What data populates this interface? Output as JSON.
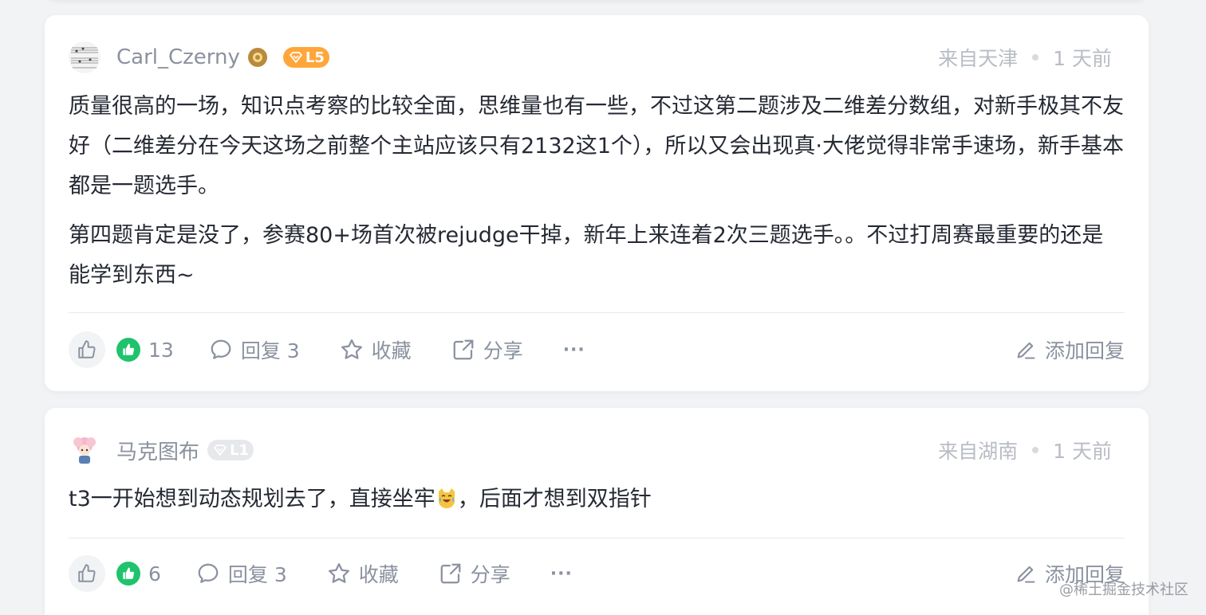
{
  "comments": [
    {
      "username": "Carl_Czerny",
      "level": "L5",
      "location": "来自天津",
      "time": "1 天前",
      "paragraphs": [
        "质量很高的一场，知识点考察的比较全面，思维量也有一些，不过这第二题涉及二维差分数组，对新手极其不友好（二维差分在今天这场之前整个主站应该只有2132这1个），所以又会出现真·大佬觉得非常手速场，新手基本都是一题选手。",
        "第四题肯定是没了，参赛80+场首次被rejudge干掉，新年上来连着2次三题选手。。不过打周赛最重要的还是能学到东西~"
      ],
      "likes": "13",
      "reply_label": "回复 3",
      "collect_label": "收藏",
      "share_label": "分享",
      "more_label": "···",
      "add_reply_label": "添加回复"
    },
    {
      "username": "马克图布",
      "level": "L1",
      "location": "来自湖南",
      "time": "1 天前",
      "content_before": "t3一开始想到动态规划去了，直接坐牢",
      "content_after": "，后面才想到双指针",
      "likes": "6",
      "reply_label": "回复 3",
      "collect_label": "收藏",
      "share_label": "分享",
      "more_label": "···",
      "add_reply_label": "添加回复"
    }
  ],
  "watermark": "@稀土掘金技术社区",
  "colors": {
    "like_green": "#1fc36d",
    "level5_orange": "#ffa63b",
    "level1_gray": "#e6e8eb",
    "text_main": "#252933",
    "text_muted": "#8a919f"
  }
}
